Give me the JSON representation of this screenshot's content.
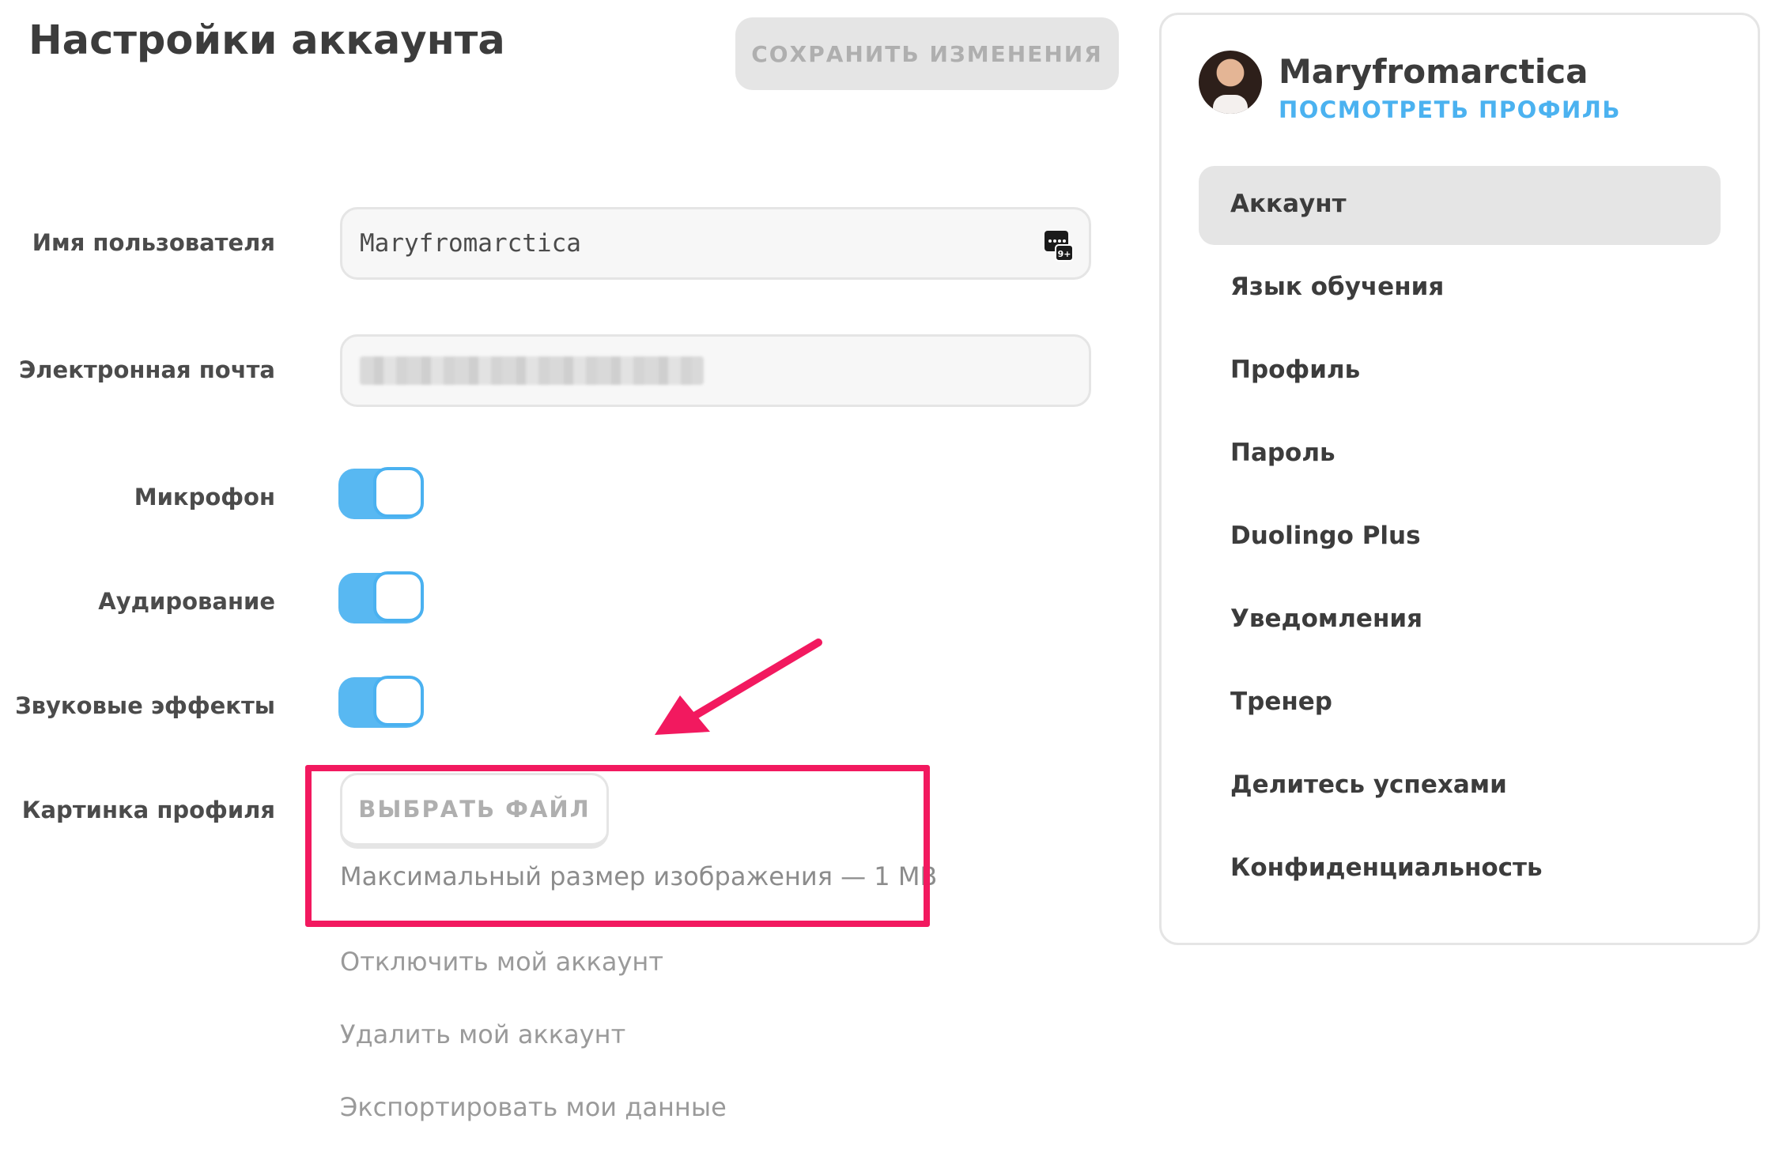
{
  "header": {
    "title": "Настройки аккаунта",
    "save_label": "СОХРАНИТЬ ИЗМЕНЕНИЯ"
  },
  "form": {
    "username_label": "Имя пользователя",
    "username_value": "Maryfromarctica",
    "email_label": "Электронная почта",
    "microphone_label": "Микрофон",
    "microphone_on": true,
    "listening_label": "Аудирование",
    "listening_on": true,
    "sound_effects_label": "Звуковые эффекты",
    "sound_effects_on": true,
    "profile_picture_label": "Картинка профиля",
    "choose_file_label": "ВЫБРАТЬ ФАЙЛ",
    "max_size_hint": "Максимальный размер изображения — 1 MB"
  },
  "account_links": {
    "disable": "Отключить мой аккаунт",
    "delete": "Удалить мой аккаунт",
    "export": "Экспортировать мои данные"
  },
  "sidebar": {
    "username": "Maryfromarctica",
    "view_profile": "ПОСМОТРЕТЬ ПРОФИЛЬ",
    "items": [
      {
        "label": "Аккаунт",
        "active": true
      },
      {
        "label": "Язык обучения"
      },
      {
        "label": "Профиль"
      },
      {
        "label": "Пароль"
      },
      {
        "label": "Duolingo Plus"
      },
      {
        "label": "Уведомления"
      },
      {
        "label": "Тренер"
      },
      {
        "label": "Делитесь успехами"
      },
      {
        "label": "Конфиденциальность"
      }
    ]
  },
  "colors": {
    "accent_blue": "#58b8f2",
    "highlight_red": "#f2195f",
    "button_gray": "#e5e5e5"
  },
  "icons": {
    "keyboard": "keyboard-icon",
    "arrow": "annotation-arrow-icon"
  }
}
